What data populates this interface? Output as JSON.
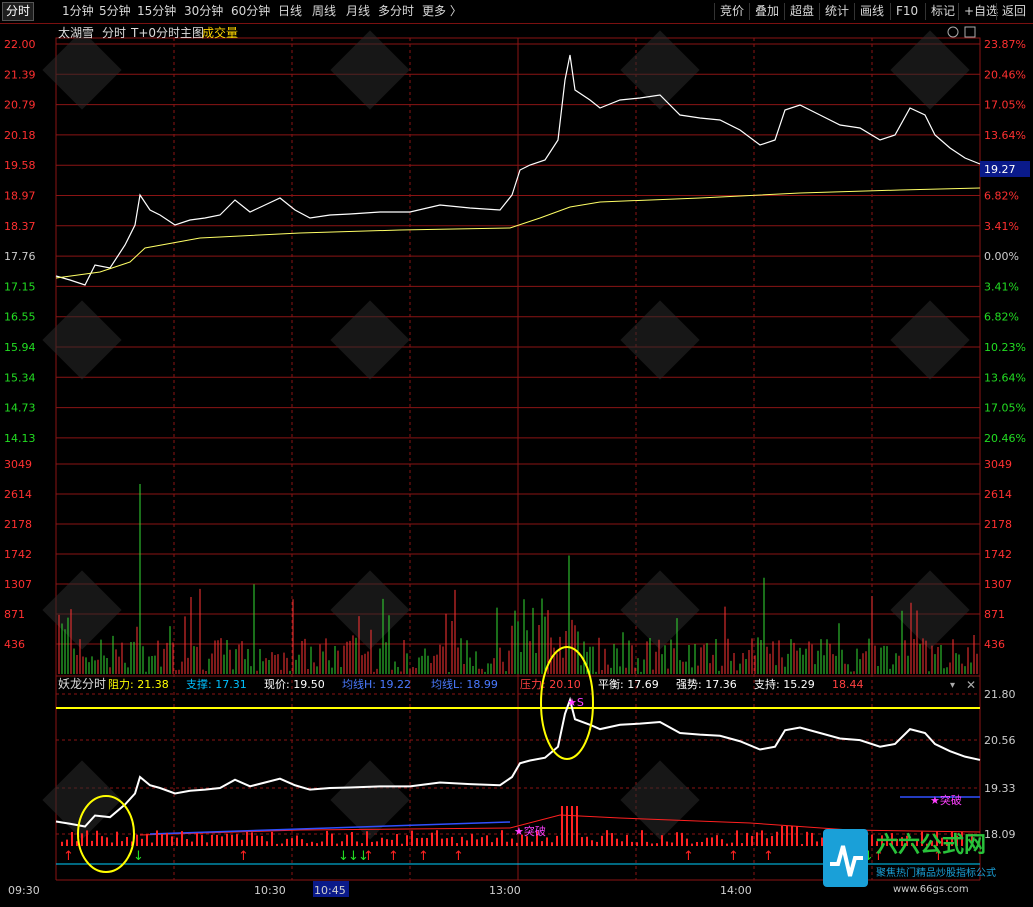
{
  "toolbar": {
    "tabs": [
      "分时",
      "1分钟",
      "5分钟",
      "15分钟",
      "30分钟",
      "60分钟",
      "日线",
      "周线",
      "月线",
      "多分时",
      "更多 〉"
    ],
    "right": [
      "竞价",
      "叠加",
      "超盘",
      "统计",
      "画线",
      "F10",
      "标记",
      "+自选",
      "返回"
    ]
  },
  "header": {
    "stock": "太湖雪",
    "mode": "分时",
    "t0": "T+0分时主图",
    "vol": "成交量"
  },
  "price_axis": {
    "left": [
      "22.00",
      "21.39",
      "20.79",
      "20.18",
      "19.58",
      "18.97",
      "18.37",
      "17.76",
      "17.15",
      "16.55",
      "15.94",
      "15.34",
      "14.73",
      "14.13"
    ],
    "right": [
      "23.87%",
      "20.46%",
      "17.05%",
      "13.64%",
      "",
      "6.82%",
      "3.41%",
      "0.00%",
      "3.41%",
      "6.82%",
      "10.23%",
      "13.64%",
      "17.05%",
      "20.46%"
    ],
    "current": "19.27"
  },
  "vol_axis": [
    "3049",
    "2614",
    "2178",
    "1742",
    "1307",
    "871",
    "436"
  ],
  "indicator": {
    "name": "妖龙分时",
    "items": [
      {
        "k": "阻力:",
        "v": "21.38",
        "c": "#ffff00"
      },
      {
        "k": "支撑:",
        "v": "17.31",
        "c": "#00c0ff"
      },
      {
        "k": "现价:",
        "v": "19.50",
        "c": "#ffffff"
      },
      {
        "k": "均线H:",
        "v": "19.22",
        "c": "#4a7aff"
      },
      {
        "k": "均线L:",
        "v": "18.99",
        "c": "#4a7aff"
      },
      {
        "k": "压力:",
        "v": "20.10",
        "c": "#ff4040"
      },
      {
        "k": "平衡:",
        "v": "17.69",
        "c": "#ffffff"
      },
      {
        "k": "强势:",
        "v": "17.36",
        "c": "#ffffff"
      },
      {
        "k": "支持:",
        "v": "15.29",
        "c": "#ffffff"
      },
      {
        "k": "",
        "v": "18.44",
        "c": "#ff4040"
      }
    ],
    "axis": [
      "21.80",
      "20.56",
      "19.33",
      "18.09"
    ],
    "tag_break": "突破",
    "tag_s": "S"
  },
  "time_axis": [
    "09:30",
    "10:30",
    "10:45",
    "13:00",
    "14:00"
  ],
  "watermark": {
    "brand": "六六公式网",
    "sub": "聚焦热门精品炒股指标公式",
    "url": "www.66gs.com"
  },
  "colors": {
    "grid": "#8a1414",
    "up": "#ff3333",
    "down": "#33dd33",
    "price": "#ffffff",
    "avg": "#ffff66"
  }
}
